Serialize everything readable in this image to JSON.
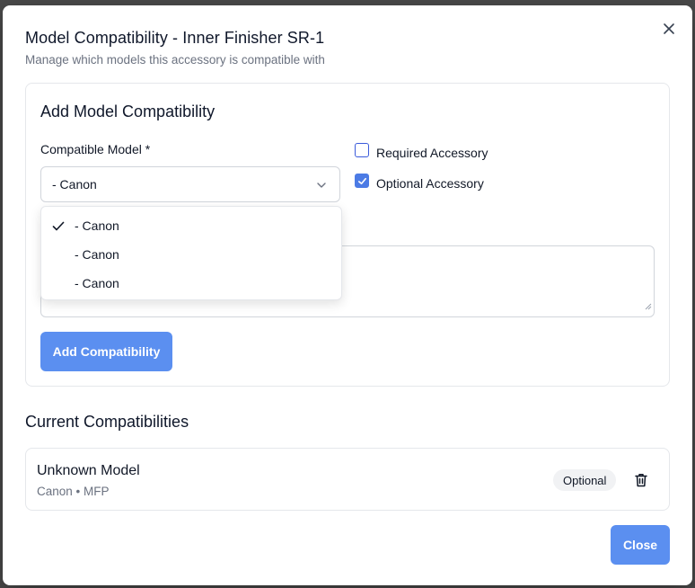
{
  "dialog": {
    "title": "Model Compatibility - Inner Finisher SR-1",
    "subtitle": "Manage which models this accessory is compatible with"
  },
  "add_section": {
    "title": "Add Model Compatibility",
    "model_label": "Compatible Model *",
    "selected_model": "- Canon",
    "options": [
      {
        "label": "- Canon",
        "selected": true
      },
      {
        "label": "- Canon",
        "selected": false
      },
      {
        "label": "- Canon",
        "selected": false
      }
    ],
    "required_label": "Required Accessory",
    "required_checked": false,
    "optional_label": "Optional Accessory",
    "optional_checked": true,
    "add_button": "Add Compatibility"
  },
  "current": {
    "title": "Current Compatibilities",
    "items": [
      {
        "name": "Unknown Model",
        "meta": "Canon • MFP",
        "badge": "Optional"
      }
    ]
  },
  "footer": {
    "close_button": "Close"
  },
  "icons": {
    "close": "close-icon",
    "chevron": "chevron-down-icon",
    "check": "check-icon",
    "trash": "trash-icon"
  },
  "colors": {
    "primary": "#5b8ff0",
    "checkbox_checked": "#4c7be5"
  }
}
